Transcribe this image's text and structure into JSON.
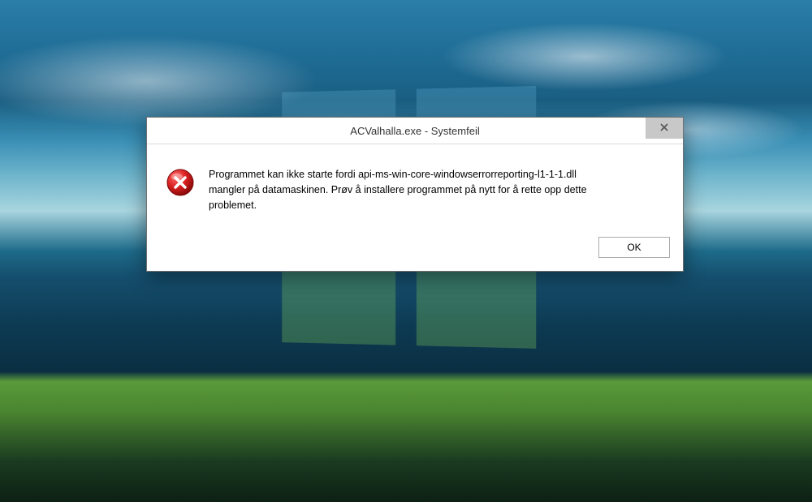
{
  "dialog": {
    "title": "ACValhalla.exe - Systemfeil",
    "message": "Programmet kan ikke starte fordi api-ms-win-core-windowserrorreporting-l1-1-1.dll mangler på datamaskinen. Prøv å installere programmet på nytt for å rette opp dette problemet.",
    "ok_label": "OK",
    "icon": "error-icon",
    "close_icon": "close-icon"
  }
}
